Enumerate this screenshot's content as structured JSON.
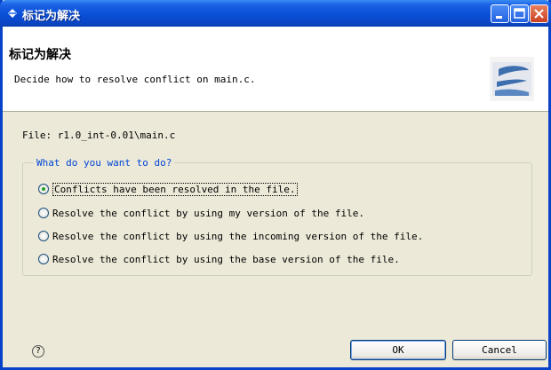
{
  "window": {
    "title": "标记为解决"
  },
  "header": {
    "title": "标记为解决",
    "description": "Decide how to resolve conflict on main.c."
  },
  "file_label": "File: r1.0_int-0.01\\main.c",
  "group": {
    "label": "What do you want to do?",
    "options": [
      {
        "label": "Conflicts have been resolved in the file.",
        "checked": true
      },
      {
        "label": "Resolve the conflict by using my version of the file.",
        "checked": false
      },
      {
        "label": "Resolve the conflict by using the incoming version of the file.",
        "checked": false
      },
      {
        "label": "Resolve the conflict by using the base version of the file.",
        "checked": false
      }
    ]
  },
  "footer": {
    "help_icon": "help-icon",
    "help_glyph": "?",
    "ok_label": "OK",
    "cancel_label": "Cancel"
  }
}
